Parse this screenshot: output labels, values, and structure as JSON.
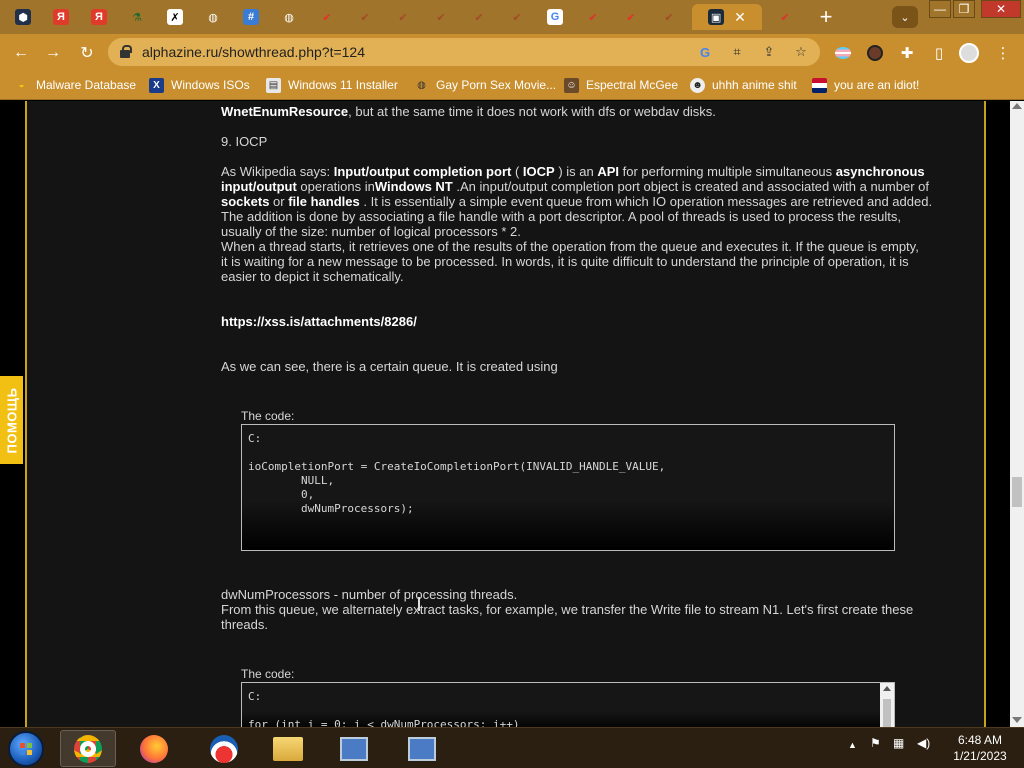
{
  "browser": {
    "url": "alphazine.ru/showthread.php?t=124",
    "tab_close": "✕",
    "new_tab": "+",
    "window_controls": {
      "minimize": "—",
      "maximize": "❐",
      "close": "✕"
    }
  },
  "bookmarks": [
    {
      "label": "Malware Database",
      "icon": "malware-db-icon"
    },
    {
      "label": "Windows ISOs",
      "icon": "x-icon"
    },
    {
      "label": "Windows 11 Installer",
      "icon": "installer-icon"
    },
    {
      "label": "Gay Porn Sex Movie...",
      "icon": "globe-icon"
    },
    {
      "label": "Espectral McGee",
      "icon": "avatar-icon"
    },
    {
      "label": "uhhh anime shit",
      "icon": "anime-icon"
    },
    {
      "label": "you are an idiot!",
      "icon": "flag-icon"
    }
  ],
  "sidebar": {
    "help_label": "ПОМОЩЬ"
  },
  "article": {
    "line_top": ", but at the same time it does not work with dfs or webdav disks.",
    "line_top_bold": "WnetEnumResource",
    "heading": "9. IOCP",
    "p1": {
      "a": "As Wikipedia says: ",
      "b": "Input/output completion port",
      "c": " ( ",
      "d": "IOCP",
      "e": " ) is an ",
      "f": "API",
      "g": " for performing multiple simultaneous ",
      "h": "asynchronous",
      "l2a": "input/output",
      "l2b": " operations in",
      "l2c": "Windows NT",
      "l2d": " .An input/output completion port object is created and associated with a number of",
      "l3a": "sockets",
      "l3b": " or ",
      "l3c": "file handles",
      "l3d": " . It is essentially a simple event queue from which IO operation messages are retrieved and added.",
      "l4": "The addition is done by associating a file handle with a port descriptor. A pool of threads is used to process the results,",
      "l5": "usually of the size: number of logical processors * 2.",
      "l6": "When a thread starts, it retrieves one of the results of the operation from the queue and executes it. If the queue is empty,",
      "l7": "it is waiting for a new message to be processed. In words, it is quite difficult to understand the principle of operation, it is",
      "l8": "easier to depict it schematically."
    },
    "attachment_link": "https://xss.is/attachments/8286/",
    "p2": "As we can see, there is a certain queue. It is created using",
    "code1_label": "The code:",
    "code1": "C:\n\nioCompletionPort = CreateIoCompletionPort(INVALID_HANDLE_VALUE,\n        NULL,\n        0,\n        dwNumProcessors);",
    "p3_l1": "dwNumProcessors - number of processing threads.",
    "p3_l2": "From this queue, we alternately extract tasks, for example, we transfer the Write file to stream N1. Let's first create these",
    "p3_l3": "threads.",
    "code2_label": "The code:",
    "code2": "C:\n\nfor (int i = 0; i < dwNumProcessors; i++)"
  },
  "taskbar": {
    "time": "6:48 AM",
    "date": "1/21/2023",
    "tray_chevron": "▲"
  }
}
